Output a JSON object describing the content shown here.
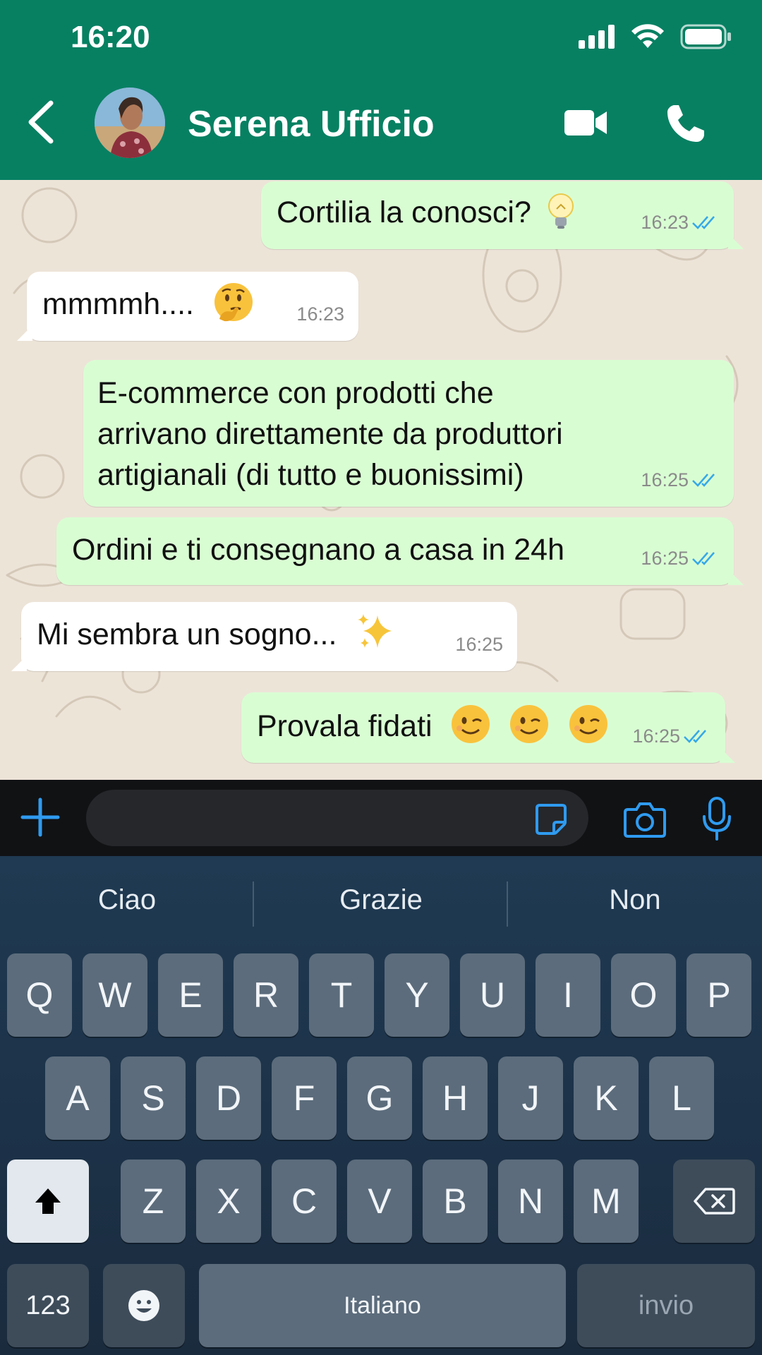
{
  "status_bar": {
    "time": "16:20"
  },
  "header": {
    "contact_name": "Serena Ufficio"
  },
  "messages": [
    {
      "direction": "out",
      "text": "Cortilia la conosci?",
      "emoji": "bulb-emoji",
      "time": "16:23",
      "read": true
    },
    {
      "direction": "in",
      "text": "mmmmh....",
      "emoji": "thinking-face-emoji",
      "time": "16:23"
    },
    {
      "direction": "out",
      "lines": [
        "E-commerce con prodotti che",
        "arrivano direttamente da produttori",
        "artigianali (di tutto e buonissimi)"
      ],
      "time": "16:25",
      "read": true
    },
    {
      "direction": "out",
      "text": "Ordini e ti consegnano a casa in 24h",
      "time": "16:25",
      "read": true
    },
    {
      "direction": "in",
      "text": "Mi sembra un sogno...",
      "emoji": "sparkles-emoji",
      "time": "16:25"
    },
    {
      "direction": "out",
      "text": "Provala fidati",
      "emoji": "winking-face-emoji x3",
      "time": "16:25",
      "read": true
    }
  ],
  "input": {
    "value": ""
  },
  "keyboard": {
    "suggestions": [
      "Ciao",
      "Grazie",
      "Non"
    ],
    "row1": [
      "Q",
      "W",
      "E",
      "R",
      "T",
      "Y",
      "U",
      "I",
      "O",
      "P"
    ],
    "row2": [
      "A",
      "S",
      "D",
      "F",
      "G",
      "H",
      "J",
      "K",
      "L"
    ],
    "row3": [
      "Z",
      "X",
      "C",
      "V",
      "B",
      "N",
      "M"
    ],
    "numbers_key": "123",
    "space_label": "Italiano",
    "return_label": "invio"
  },
  "colors": {
    "header": "#078062",
    "outgoing_bubble": "#d9fdd3",
    "incoming_bubble": "#ffffff",
    "chat_bg": "#ede4d8",
    "accent_blue": "#2f9bf0"
  }
}
